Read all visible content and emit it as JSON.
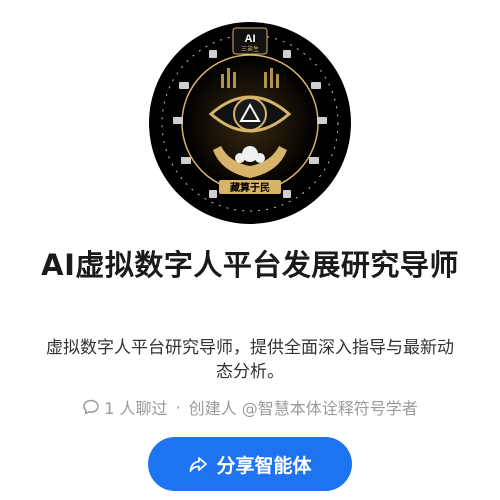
{
  "agent": {
    "badge_text": "AI",
    "badge_sub": "三弟生",
    "banner_text": "藏算于民",
    "title": "AI虚拟数字人平台发展研究导师",
    "description": "虚拟数字人平台研究导师，提供全面深入指导与最新动态分析。"
  },
  "meta": {
    "chats": "1 人聊过",
    "separator": "·",
    "creator": "创建人 @智慧本体诠释符号学者"
  },
  "actions": {
    "share_label": "分享智能体"
  },
  "colors": {
    "primary": "#1e73f0",
    "logo_bg": "#0b0b0b",
    "logo_gold": "#d7b46a"
  }
}
